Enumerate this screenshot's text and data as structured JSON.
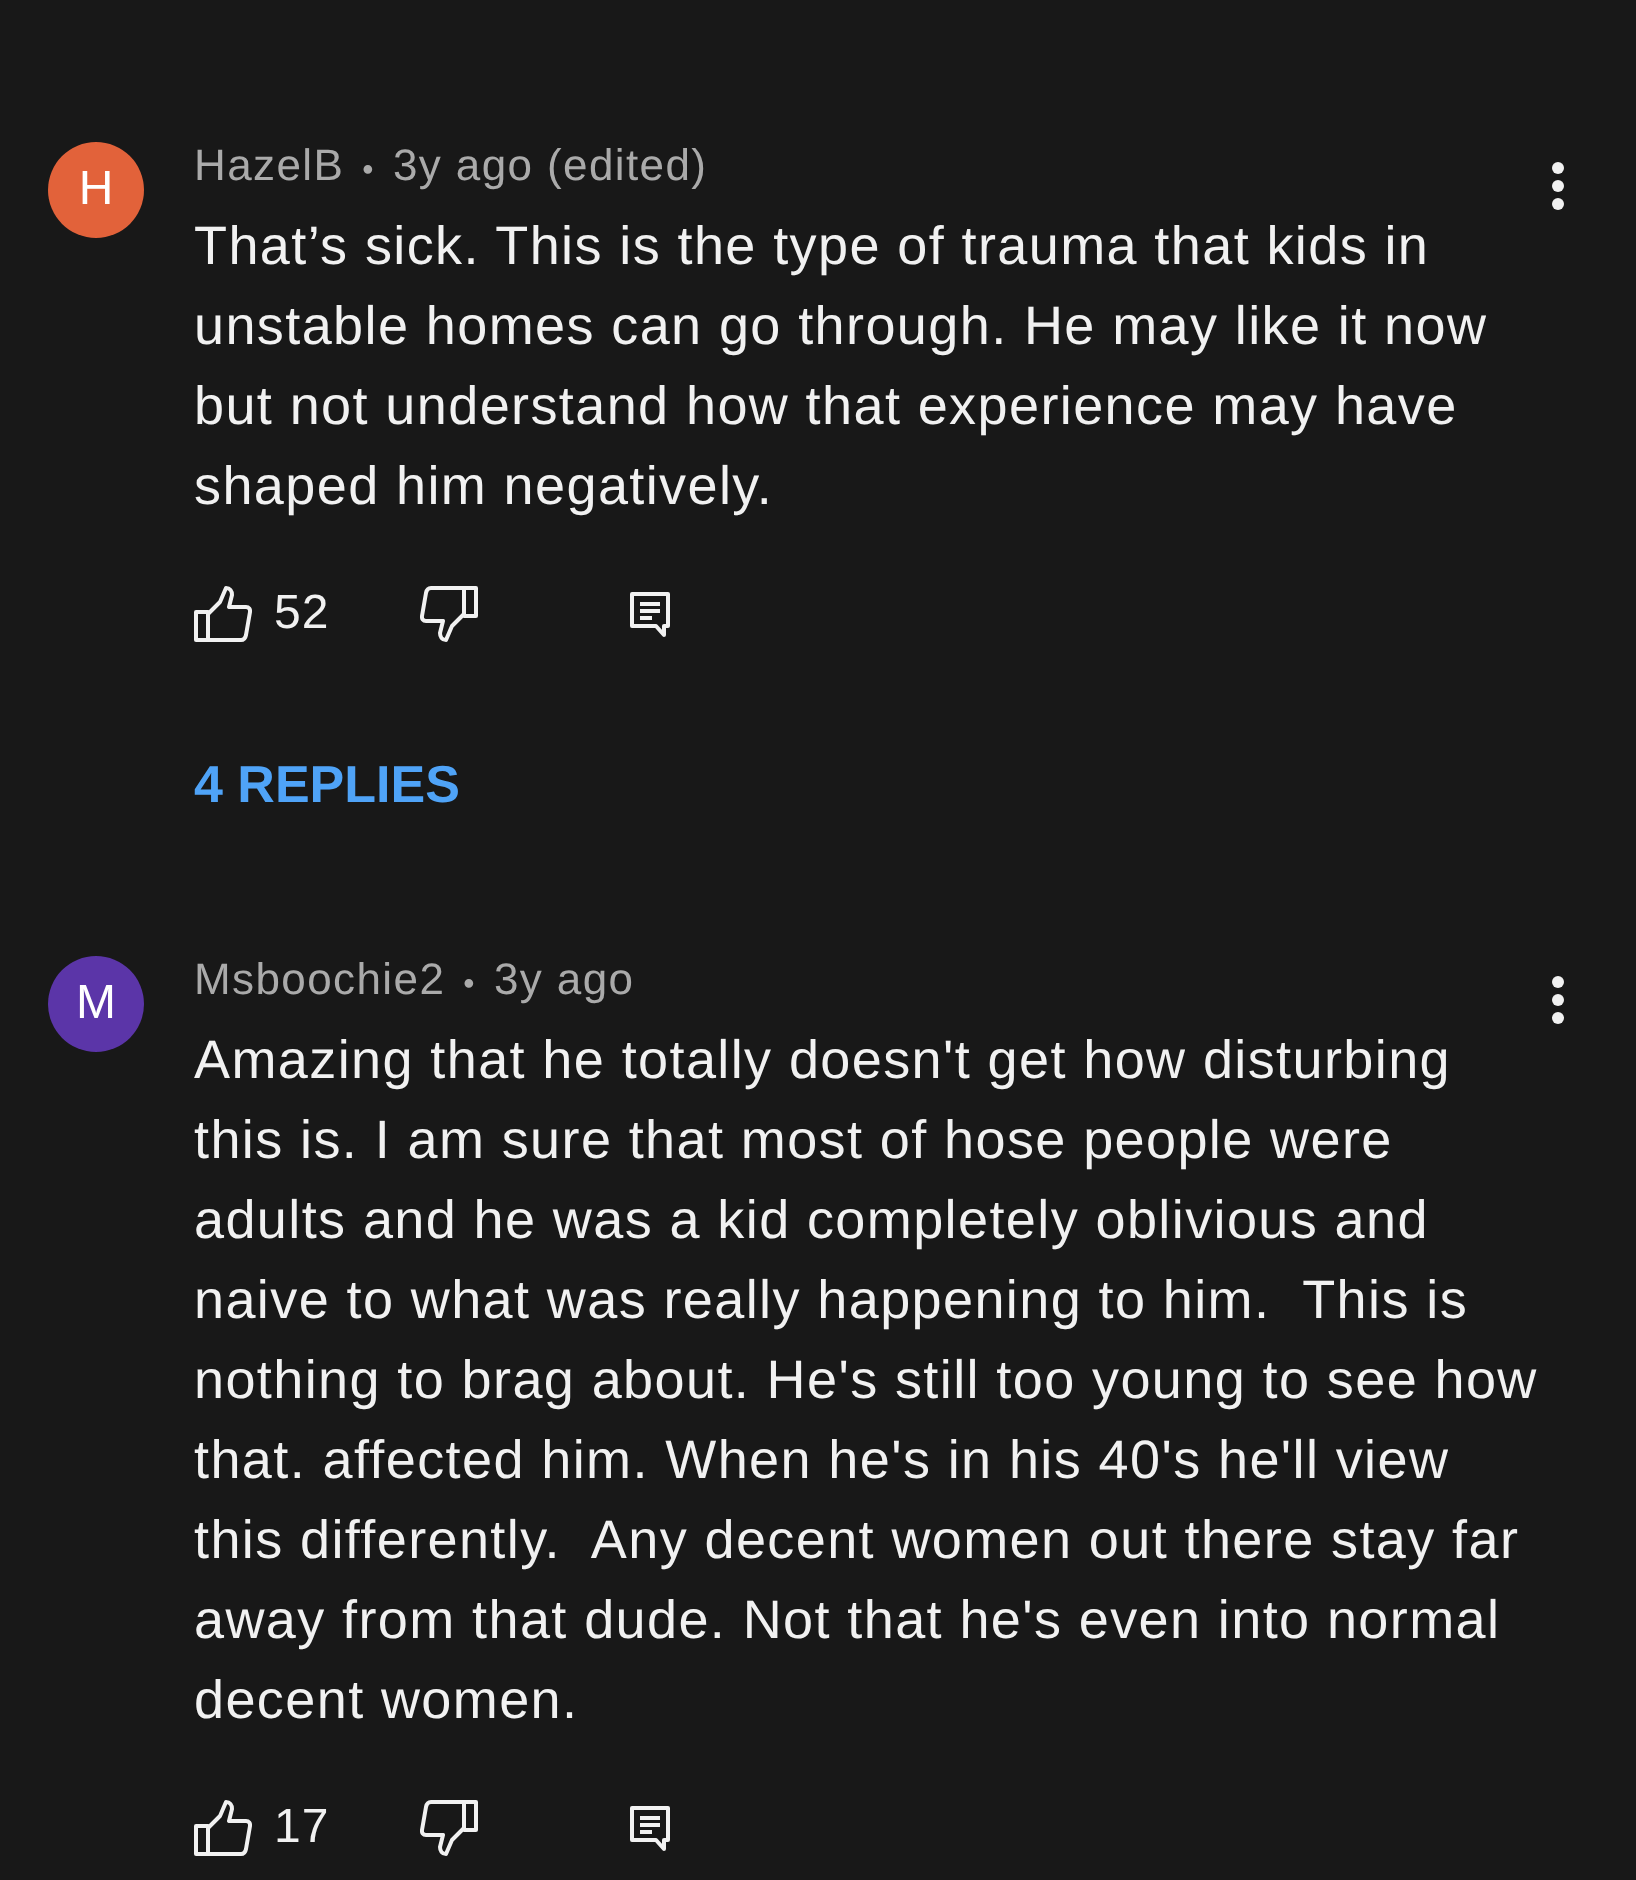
{
  "comments": [
    {
      "avatar": {
        "letter": "H",
        "color": "#e2623a"
      },
      "author": "HazelB",
      "separator": "•",
      "time": "3y ago (edited)",
      "text": "That’s sick. This is the type of trauma that kids in unstable homes can go through. He may like it now but not understand how that experience may have shaped him negatively.",
      "likes": "52",
      "replies": "4 REPLIES"
    },
    {
      "avatar": {
        "letter": "M",
        "color": "#5b35a8"
      },
      "author": "Msboochie2",
      "separator": "•",
      "time": "3y ago",
      "text": "Amazing that he totally doesn't get how disturbing this is. I am sure that most of hose people were adults and he was a kid completely oblivious and naive to what was really happening to him.  This is nothing to brag about. He's still too young to see how that. affected him. When he's in his 40's he'll view this differently.  Any decent women out there stay far away from that dude. Not that he's even into normal decent women.",
      "likes": "17"
    }
  ]
}
